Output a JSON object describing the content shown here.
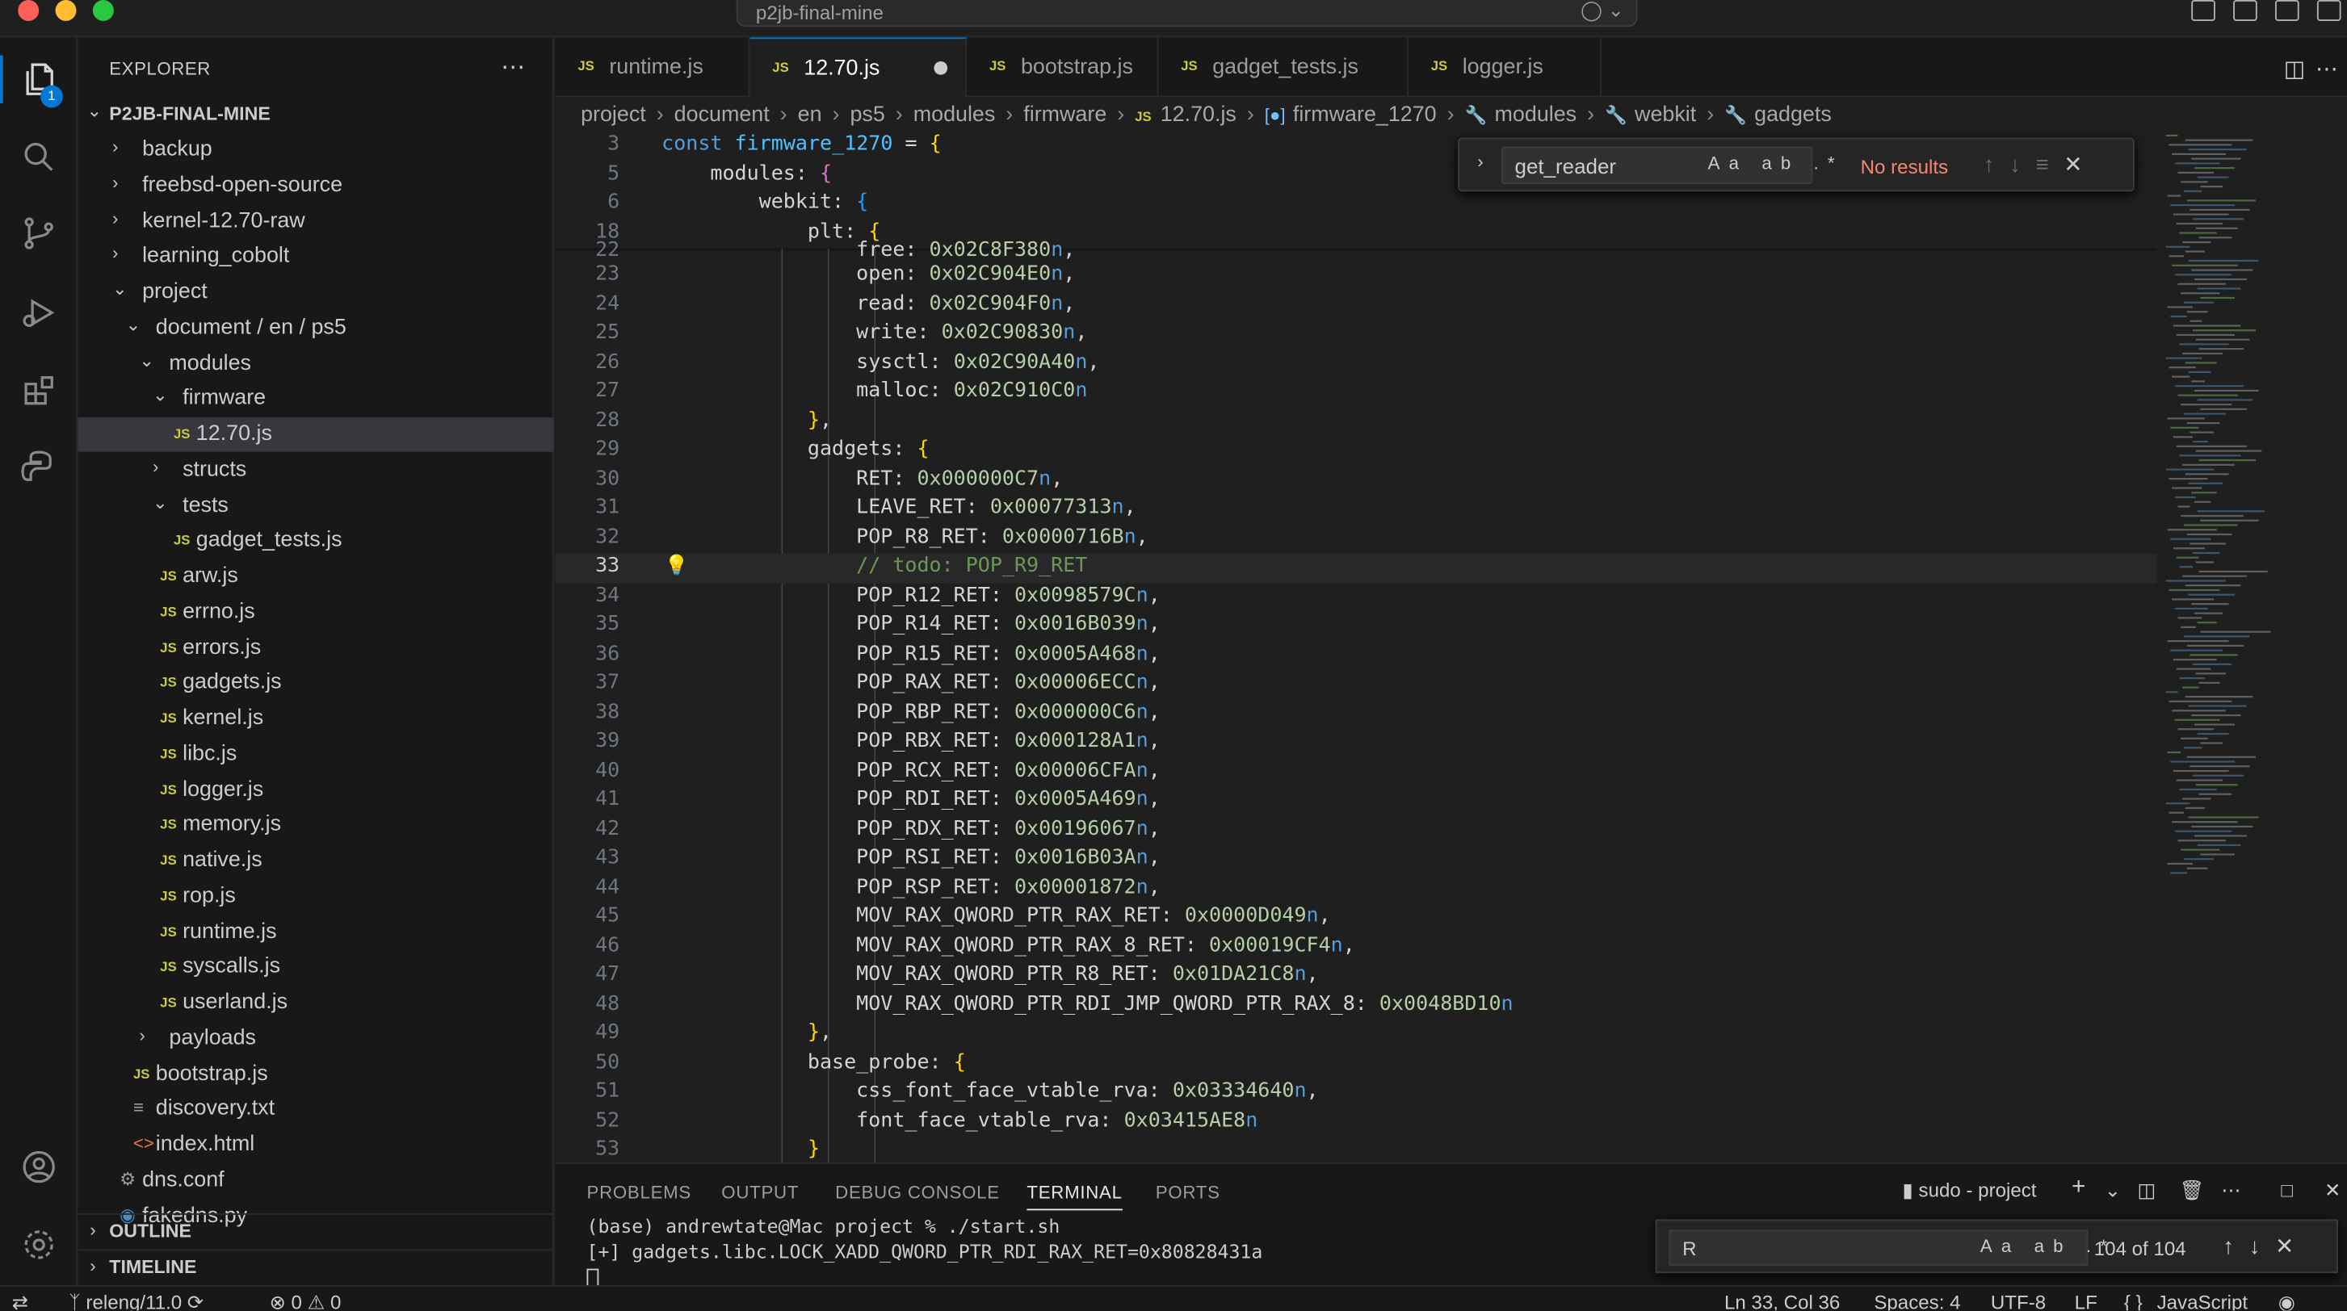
{
  "window": {
    "title": "p2jb-final-mine"
  },
  "sidebar": {
    "title": "EXPLORER",
    "root": "P2JB-FINAL-MINE",
    "outline": "OUTLINE",
    "timeline": "TIMELINE",
    "items": [
      {
        "label": "backup",
        "kind": "folder",
        "expanded": false
      },
      {
        "label": "freebsd-open-source",
        "kind": "folder",
        "expanded": false
      },
      {
        "label": "kernel-12.70-raw",
        "kind": "folder",
        "expanded": false
      },
      {
        "label": "learning_cobolt",
        "kind": "folder",
        "expanded": false
      },
      {
        "label": "project",
        "kind": "folder",
        "expanded": true
      },
      {
        "label": "document / en / ps5",
        "kind": "folder",
        "expanded": true
      },
      {
        "label": "modules",
        "kind": "folder",
        "expanded": true
      },
      {
        "label": "firmware",
        "kind": "folder",
        "expanded": true
      },
      {
        "label": "12.70.js",
        "kind": "js",
        "selected": true
      },
      {
        "label": "structs",
        "kind": "folder",
        "expanded": false
      },
      {
        "label": "tests",
        "kind": "folder",
        "expanded": true
      },
      {
        "label": "gadget_tests.js",
        "kind": "js"
      },
      {
        "label": "arw.js",
        "kind": "js"
      },
      {
        "label": "errno.js",
        "kind": "js"
      },
      {
        "label": "errors.js",
        "kind": "js"
      },
      {
        "label": "gadgets.js",
        "kind": "js"
      },
      {
        "label": "kernel.js",
        "kind": "js"
      },
      {
        "label": "libc.js",
        "kind": "js"
      },
      {
        "label": "logger.js",
        "kind": "js"
      },
      {
        "label": "memory.js",
        "kind": "js"
      },
      {
        "label": "native.js",
        "kind": "js"
      },
      {
        "label": "rop.js",
        "kind": "js"
      },
      {
        "label": "runtime.js",
        "kind": "js"
      },
      {
        "label": "syscalls.js",
        "kind": "js"
      },
      {
        "label": "userland.js",
        "kind": "js"
      },
      {
        "label": "payloads",
        "kind": "folder",
        "expanded": false
      },
      {
        "label": "bootstrap.js",
        "kind": "js"
      },
      {
        "label": "discovery.txt",
        "kind": "txt"
      },
      {
        "label": "index.html",
        "kind": "html"
      },
      {
        "label": "dns.conf",
        "kind": "conf"
      },
      {
        "label": "fakedns.py",
        "kind": "py"
      }
    ]
  },
  "activity": {
    "explorer_badge": "1"
  },
  "tabs": [
    {
      "label": "runtime.js",
      "active": false
    },
    {
      "label": "12.70.js",
      "active": true,
      "modified": true
    },
    {
      "label": "bootstrap.js",
      "active": false
    },
    {
      "label": "gadget_tests.js",
      "active": false
    },
    {
      "label": "logger.js",
      "active": false
    }
  ],
  "breadcrumbs": [
    "project",
    "document",
    "en",
    "ps5",
    "modules",
    "firmware",
    "12.70.js",
    "firmware_1270",
    "modules",
    "webkit",
    "gadgets"
  ],
  "find": {
    "query": "get_reader",
    "result": "No results",
    "options": "Aa ab .*"
  },
  "sticky": [
    {
      "n": "3",
      "html": "<span class='kw'>const</span> <span class='var'>firmware_1270</span> = <span class='br1'>{</span>"
    },
    {
      "n": "5",
      "html": "    modules: <span class='br2'>{</span>"
    },
    {
      "n": "6",
      "html": "        webkit: <span class='br3'>{</span>"
    },
    {
      "n": "18",
      "html": "            plt: <span class='br1'>{</span>"
    }
  ],
  "lines": [
    {
      "n": "22",
      "text": "                free: 0x02C8F380n,",
      "partial": true
    },
    {
      "n": "23",
      "text": "                open: 0x02C904E0n,"
    },
    {
      "n": "24",
      "text": "                read: 0x02C904F0n,"
    },
    {
      "n": "25",
      "text": "                write: 0x02C90830n,"
    },
    {
      "n": "26",
      "text": "                sysctl: 0x02C90A40n,"
    },
    {
      "n": "27",
      "text": "                malloc: 0x02C910C0n"
    },
    {
      "n": "28",
      "text": "            },"
    },
    {
      "n": "29",
      "text": "            gadgets: {"
    },
    {
      "n": "30",
      "text": "                RET: 0x000000C7n,"
    },
    {
      "n": "31",
      "text": "                LEAVE_RET: 0x00077313n,"
    },
    {
      "n": "32",
      "text": "                POP_R8_RET: 0x0000716Bn,"
    },
    {
      "n": "33",
      "text": "                // todo: POP_R9_RET",
      "current": true
    },
    {
      "n": "34",
      "text": "                POP_R12_RET: 0x0098579Cn,"
    },
    {
      "n": "35",
      "text": "                POP_R14_RET: 0x0016B039n,"
    },
    {
      "n": "36",
      "text": "                POP_R15_RET: 0x0005A468n,"
    },
    {
      "n": "37",
      "text": "                POP_RAX_RET: 0x00006ECCn,"
    },
    {
      "n": "38",
      "text": "                POP_RBP_RET: 0x000000C6n,"
    },
    {
      "n": "39",
      "text": "                POP_RBX_RET: 0x000128A1n,"
    },
    {
      "n": "40",
      "text": "                POP_RCX_RET: 0x00006CFAn,"
    },
    {
      "n": "41",
      "text": "                POP_RDI_RET: 0x0005A469n,"
    },
    {
      "n": "42",
      "text": "                POP_RDX_RET: 0x00196067n,"
    },
    {
      "n": "43",
      "text": "                POP_RSI_RET: 0x0016B03An,"
    },
    {
      "n": "44",
      "text": "                POP_RSP_RET: 0x00001872n,"
    },
    {
      "n": "45",
      "text": "                MOV_RAX_QWORD_PTR_RAX_RET: 0x0000D049n,"
    },
    {
      "n": "46",
      "text": "                MOV_RAX_QWORD_PTR_RAX_8_RET: 0x00019CF4n,"
    },
    {
      "n": "47",
      "text": "                MOV_RAX_QWORD_PTR_R8_RET: 0x01DA21C8n,"
    },
    {
      "n": "48",
      "text": "                MOV_RAX_QWORD_PTR_RDI_JMP_QWORD_PTR_RAX_8: 0x0048BD10n"
    },
    {
      "n": "49",
      "text": "            },"
    },
    {
      "n": "50",
      "text": "            base_probe: {"
    },
    {
      "n": "51",
      "text": "                css_font_face_vtable_rva: 0x03334640n,"
    },
    {
      "n": "52",
      "text": "                font_face_vtable_rva: 0x03415AE8n"
    },
    {
      "n": "53",
      "text": "            }"
    }
  ],
  "panel": {
    "tabs": [
      "PROBLEMS",
      "OUTPUT",
      "DEBUG CONSOLE",
      "TERMINAL",
      "PORTS"
    ],
    "active_tab": "TERMINAL",
    "terminal_name": "sudo - project",
    "terminal_lines": [
      "(base) andrewtate@Mac project % ./start.sh",
      "[+] gadgets.libc.LOCK_XADD_QWORD_PTR_RDI_RAX_RET=0x80828431a"
    ],
    "find": {
      "query": "R",
      "count": "104 of 104",
      "options": "Aa ab .*"
    }
  },
  "status": {
    "branch": "releng/11.0",
    "problems": "0",
    "warnings": "0",
    "position": "Ln 33, Col 36",
    "spaces": "Spaces: 4",
    "encoding": "UTF-8",
    "eol": "LF",
    "language": "JavaScript",
    "language_braces": "{ }"
  },
  "colors": {
    "accent": "#0078d4",
    "keyword": "#569cd6",
    "number": "#b5cea8",
    "comment": "#6a9955",
    "error_text": "#f48771",
    "js_icon": "#cbcb41"
  }
}
